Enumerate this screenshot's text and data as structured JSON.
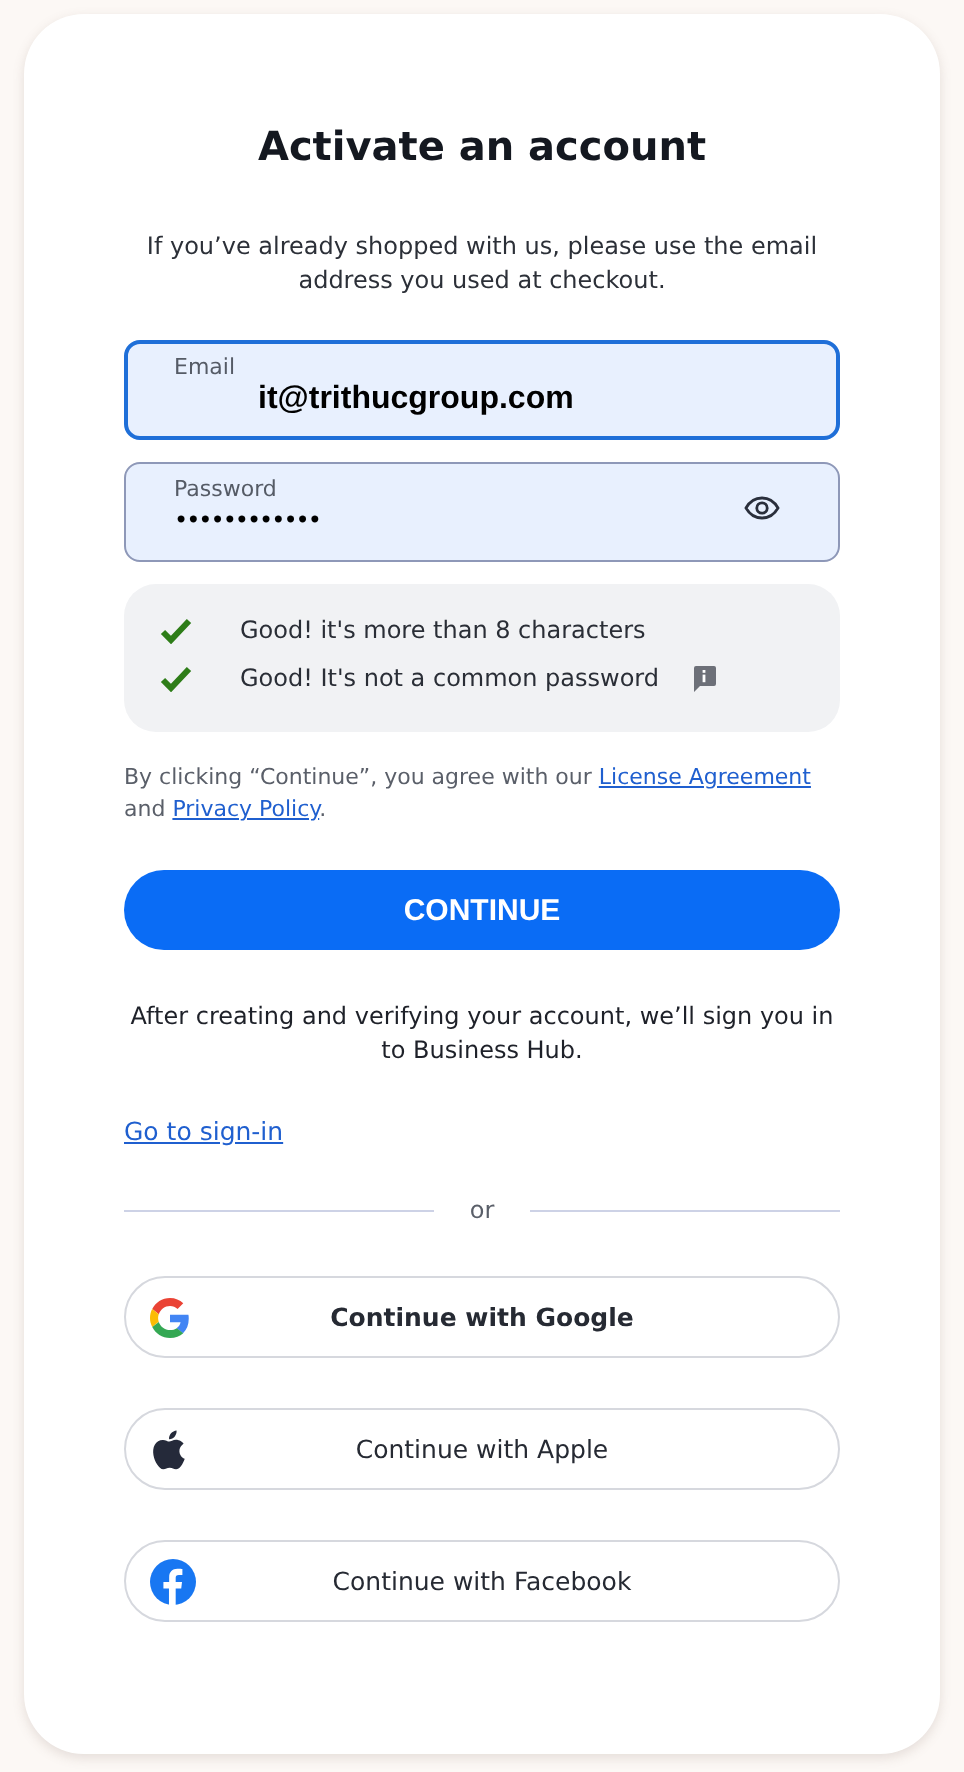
{
  "title": "Activate an account",
  "subtitle": "If you’ve already shopped with us, please use the email address you used at checkout.",
  "email": {
    "label": "Email",
    "value": "it@trithucgroup.com",
    "focused": true
  },
  "password": {
    "label": "Password",
    "value": "••••••••••••",
    "focused": false
  },
  "checks": [
    {
      "text": "Good! it's more than 8 characters",
      "passed": true,
      "info": false
    },
    {
      "text": "Good! It's not a common password",
      "passed": true,
      "info": true
    }
  ],
  "terms": [
    {
      "kind": "text",
      "text": "By clicking “Continue”, you agree with our "
    },
    {
      "kind": "link",
      "text": "License Agreement"
    },
    {
      "kind": "text",
      "text": " and "
    },
    {
      "kind": "link",
      "text": "Privacy Policy"
    },
    {
      "kind": "text",
      "text": "."
    }
  ],
  "continue_button": "CONTINUE",
  "after_text": "After creating and verifying your account, we’ll sign you in to Business Hub.",
  "sign_in_link": "Go to sign-in",
  "divider": "or",
  "social_buttons": [
    {
      "kind": "google",
      "label": "Continue with Google"
    },
    {
      "kind": "apple",
      "label": "Continue with Apple"
    },
    {
      "kind": "facebook",
      "label": "Continue with Facebook"
    }
  ]
}
